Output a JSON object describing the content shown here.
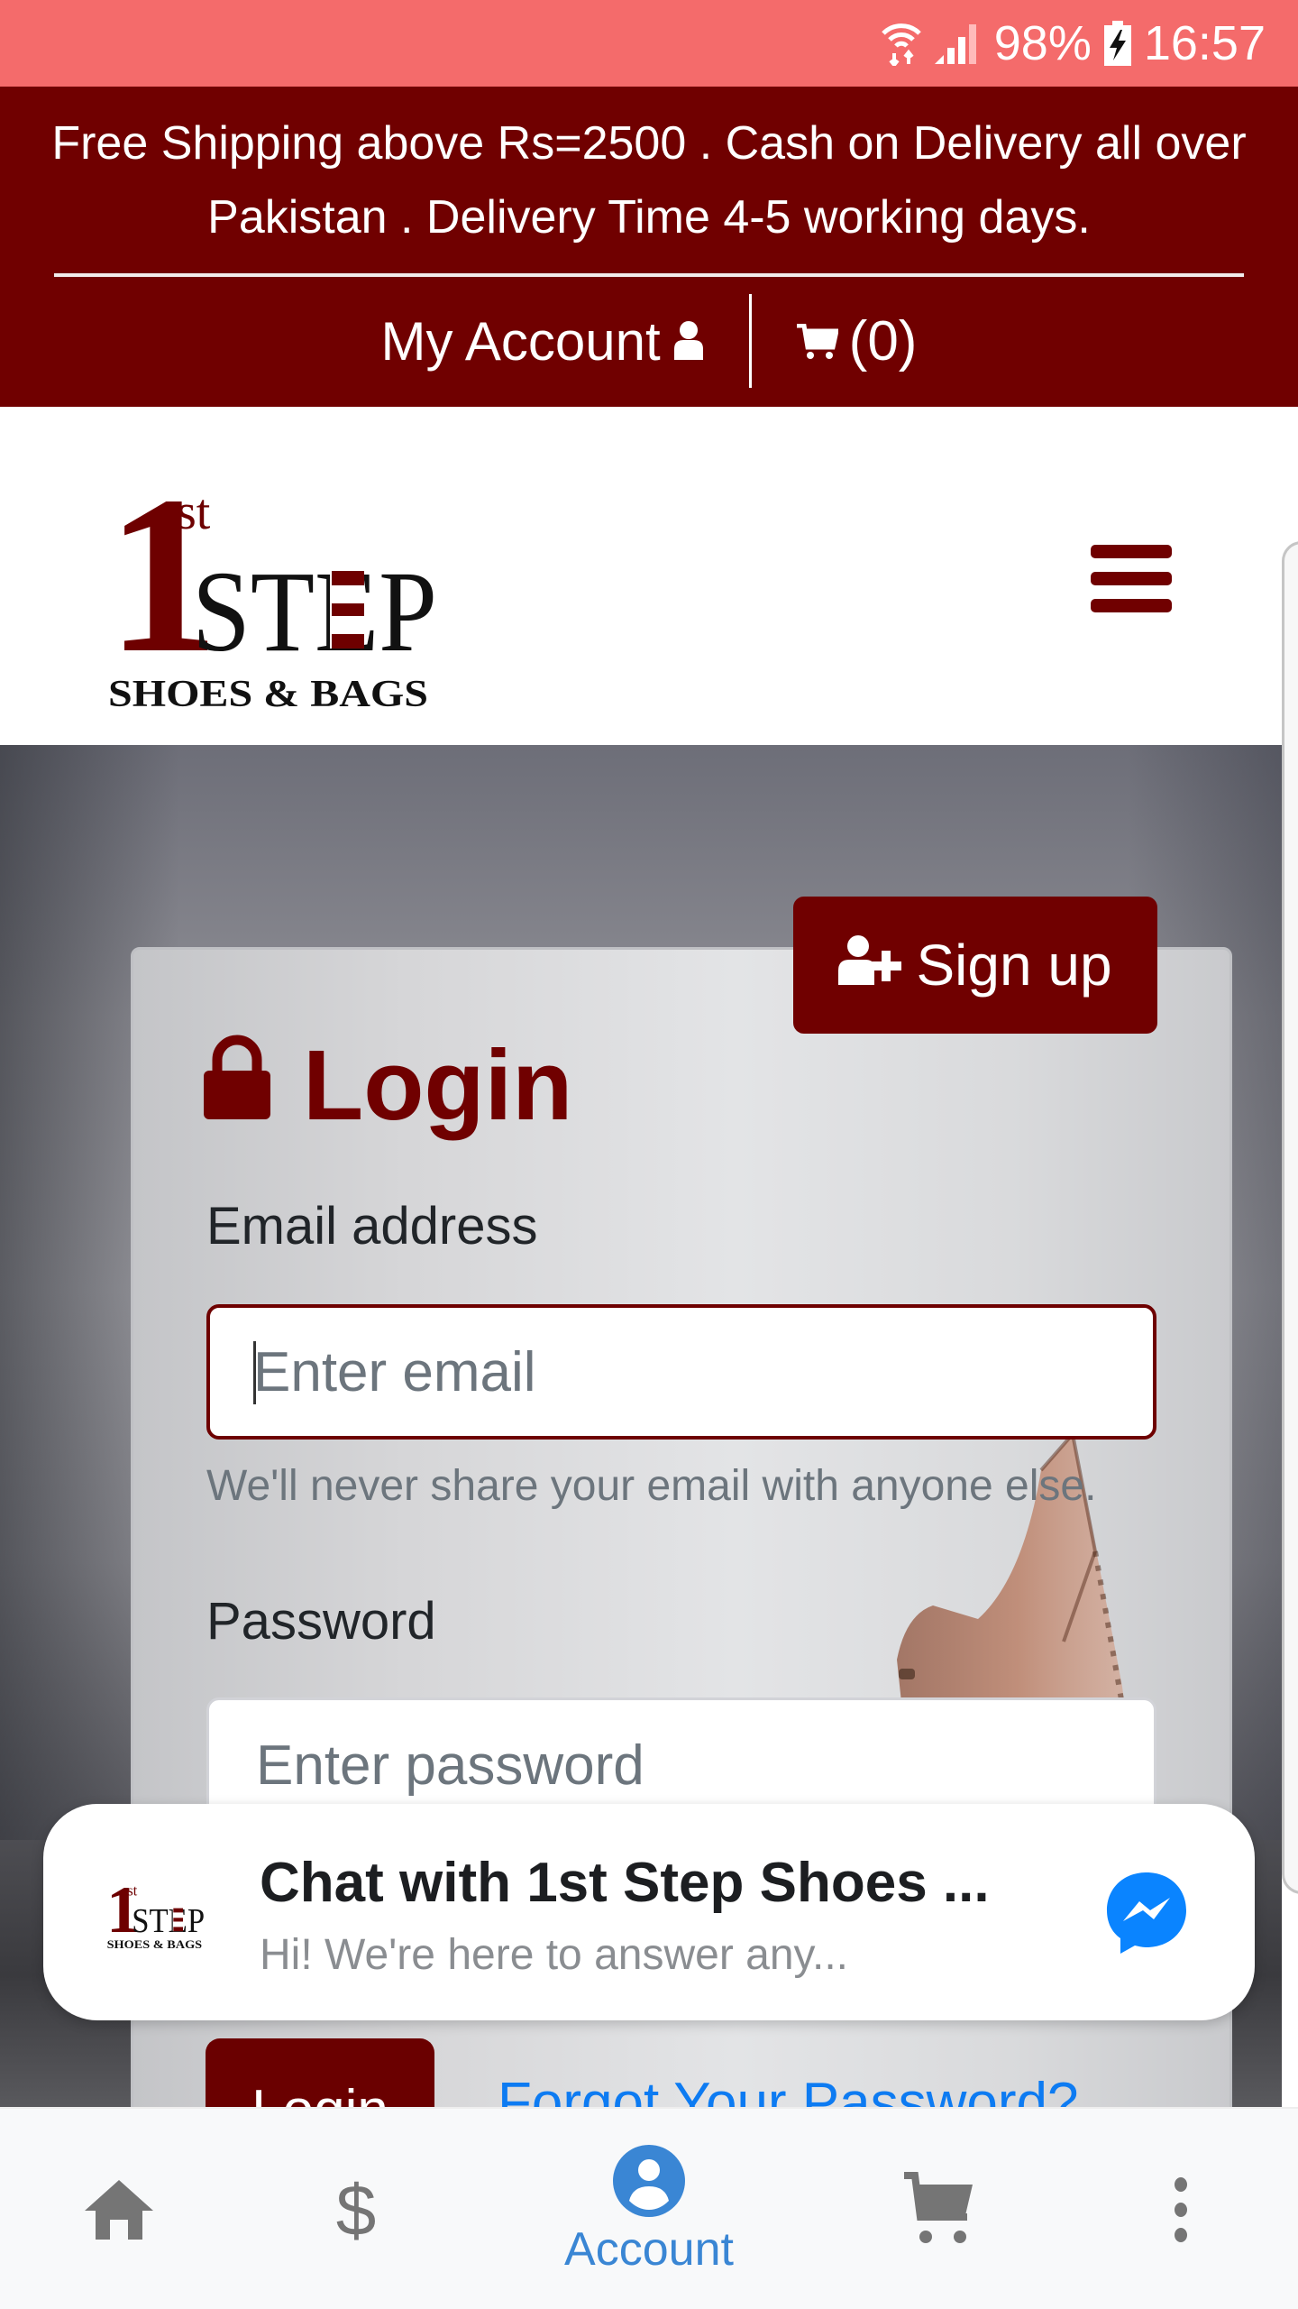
{
  "status_bar": {
    "battery_percent": "98%",
    "time": "16:57",
    "icons": [
      "wifi-icon",
      "signal-icon",
      "battery-charging-icon"
    ]
  },
  "top_bar": {
    "notice": "Free Shipping above Rs=2500 . Cash on Delivery all over Pakistan . Delivery Time 4-5 working days.",
    "my_account_label": "My Account",
    "cart_count": "(0)",
    "colors": {
      "background": "#700000",
      "text": "#ffffff"
    }
  },
  "header": {
    "logo": {
      "number": "1",
      "superscript": "st",
      "word": "STEP",
      "tagline": "SHOES & BAGS"
    },
    "menu_icon": "hamburger-icon"
  },
  "login_form": {
    "signup_label": "Sign up",
    "title": "Login",
    "email_label": "Email address",
    "email_placeholder": "Enter email",
    "email_value": "",
    "email_help": "We'll never share your email with anyone else.",
    "password_label": "Password",
    "password_placeholder": "Enter password",
    "password_value": "",
    "login_button": "Login",
    "forgot_link": "Forgot Your Password?",
    "accent_color": "#700000",
    "link_color": "#0d7bf2"
  },
  "chat_widget": {
    "title": "Chat with 1st Step Shoes ...",
    "subtitle": "Hi! We're here to answer any...",
    "icon": "messenger-icon",
    "icon_color": "#0a84ff"
  },
  "bottom_nav": {
    "items": [
      {
        "name": "home",
        "icon": "home-icon",
        "label": "",
        "active": false
      },
      {
        "name": "pricing",
        "icon": "dollar-icon",
        "label": "",
        "active": false
      },
      {
        "name": "account",
        "icon": "account-circle-icon",
        "label": "Account",
        "active": true
      },
      {
        "name": "cart",
        "icon": "cart-icon",
        "label": "",
        "active": false
      },
      {
        "name": "more",
        "icon": "more-vertical-icon",
        "label": "",
        "active": false
      }
    ],
    "active_color": "#3a86d4",
    "inactive_color": "#757575"
  }
}
